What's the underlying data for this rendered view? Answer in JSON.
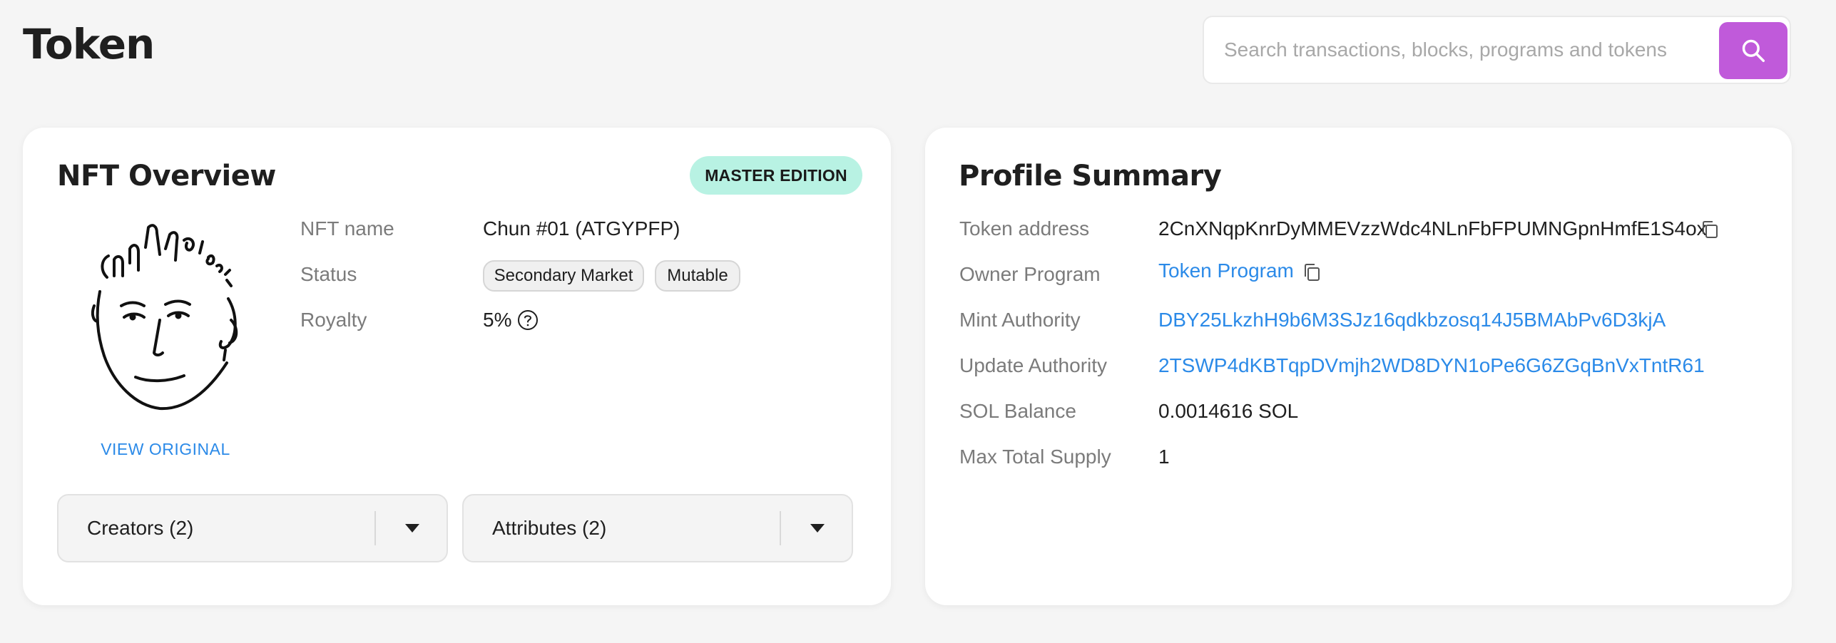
{
  "header": {
    "title": "Token",
    "search": {
      "placeholder": "Search transactions, blocks, programs and tokens",
      "value": ""
    },
    "search_button_icon": "search-icon"
  },
  "nft_overview": {
    "title": "NFT Overview",
    "edition_badge": "MASTER EDITION",
    "view_original": "VIEW ORIGINAL",
    "avatar_icon": "nft-avatar-drawing",
    "fields": {
      "name_label": "NFT name",
      "name_value": "Chun #01 (ATGYPFP)",
      "status_label": "Status",
      "status_chips": [
        "Secondary Market",
        "Mutable"
      ],
      "royalty_label": "Royalty",
      "royalty_value": "5%"
    },
    "creators_label": "Creators (2)",
    "attributes_label": "Attributes (2)"
  },
  "profile_summary": {
    "title": "Profile Summary",
    "rows": [
      {
        "label": "Token address",
        "value": "2CnXNqpKnrDyMMEVzzWdc4NLnFbFPUMNGpnHmfE1S4ox"
      },
      {
        "label": "Owner Program",
        "value": "Token Program"
      },
      {
        "label": "Mint Authority",
        "value": "DBY25LkzhH9b6M3SJz16qdkbzosq14J5BMAbPv6D3kjA"
      },
      {
        "label": "Update Authority",
        "value": "2TSWP4dKBTqpDVmjh2WD8DYN1oPe6G6ZGqBnVxTntR61"
      },
      {
        "label": "SOL Balance",
        "value": "0.0014616 SOL"
      },
      {
        "label": "Max Total Supply",
        "value": "1"
      }
    ]
  },
  "colors": {
    "accent": "#c05ada",
    "link": "#2b8ae8",
    "badge_bg": "#b8f2e3",
    "background": "#f5f5f5"
  }
}
